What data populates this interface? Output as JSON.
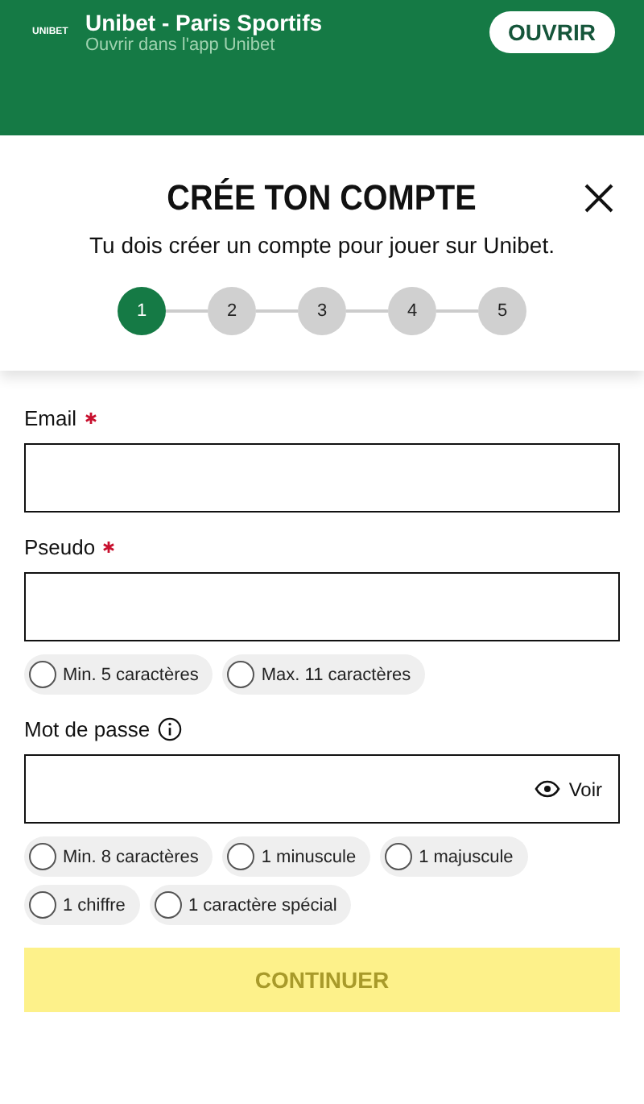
{
  "app_banner": {
    "logo": "UNIBET",
    "title": "Unibet - Paris Sportifs",
    "subtitle": "Ouvrir dans l'app Unibet",
    "button": "OUVRIR"
  },
  "header": {
    "title": "CRÉE TON COMPTE",
    "subtitle": "Tu dois créer un compte pour jouer sur Unibet."
  },
  "steps": [
    {
      "label": "1",
      "selected": true
    },
    {
      "label": "2",
      "selected": false
    },
    {
      "label": "3",
      "selected": false
    },
    {
      "label": "4",
      "selected": false
    },
    {
      "label": "5",
      "selected": false
    }
  ],
  "fields": [
    {
      "label": "Email",
      "required": true,
      "kind": "text"
    },
    {
      "label": "Pseudo",
      "required": true,
      "kind": "text",
      "rules": [
        [
          {
            "label": "Min. 5 caractères",
            "checked": false
          },
          {
            "label": "Max. 11 caractères",
            "checked": false
          }
        ]
      ]
    },
    {
      "label": "Mot de passe",
      "required": false,
      "kind": "password",
      "toggle": "Voir",
      "rules": [
        [
          {
            "label": "Min. 8 caractères",
            "checked": false
          },
          {
            "label": "1 minuscule",
            "checked": false
          },
          {
            "label": "1 majuscule",
            "checked": false
          }
        ],
        [
          {
            "label": "1 chiffre",
            "checked": false
          },
          {
            "label": "1 caractère spécial",
            "checked": false
          }
        ]
      ]
    }
  ],
  "submit": {
    "label": "CONTINUER",
    "disabled": true
  }
}
